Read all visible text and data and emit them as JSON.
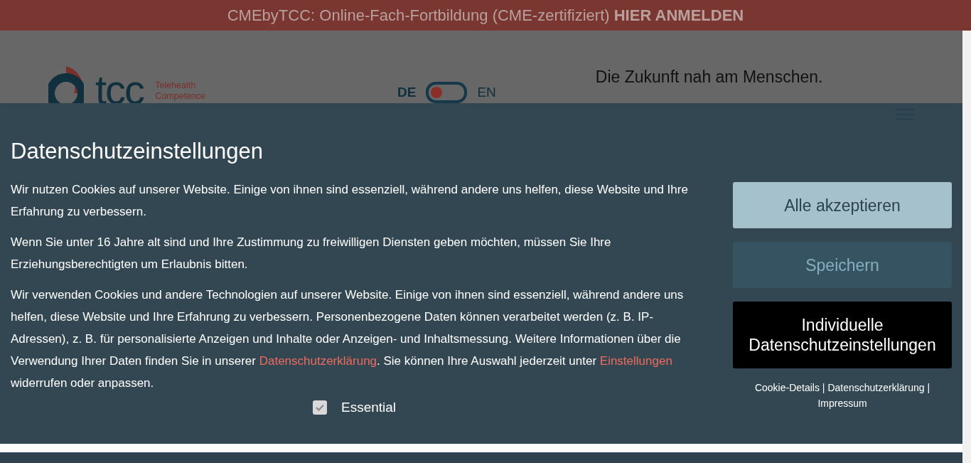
{
  "banner": {
    "text": "CMEbyTCC: Online-Fach-Fortbildung (CME-zertifiziert) **HIER ANMELDEN**"
  },
  "header": {
    "logo": {
      "wordmark": "tcc",
      "lines": [
        "Telehealth",
        "Competence"
      ]
    },
    "languages": [
      {
        "label": "DE",
        "selected": true
      },
      {
        "label": "EN",
        "selected": false
      }
    ],
    "tagline": "Die Zukunft nah am Menschen."
  },
  "cookie_panel": {
    "title": "Datenschutzeinstellungen",
    "paragraphs": [
      {
        "parts": [
          {
            "kind": "text",
            "text": "Wir nutzen Cookies auf unserer Website. Einige von ihnen sind essenziell, während andere uns helfen, diese Website und Ihre Erfahrung zu verbessern."
          }
        ]
      },
      {
        "parts": [
          {
            "kind": "text",
            "text": "Wenn Sie unter 16 Jahre alt sind und Ihre Zustimmung zu freiwilligen Diensten geben möchten, müssen Sie Ihre Erziehungsberechtigten um Erlaubnis bitten."
          }
        ]
      },
      {
        "parts": [
          {
            "kind": "text",
            "text": "Wir verwenden Cookies und andere Technologien auf unserer Website. Einige von ihnen sind essenziell, während andere uns helfen, diese Website und Ihre Erfahrung zu verbessern. Personenbezogene Daten können verarbeitet werden (z. B. IP-Adressen), z. B. für personalisierte Anzeigen und Inhalte oder Anzeigen- und Inhaltsmessung. Weitere Informationen über die Verwendung Ihrer Daten finden Sie in unserer "
          },
          {
            "kind": "link",
            "text": "Datenschutzerklärung"
          },
          {
            "kind": "text",
            "text": ". Sie können Ihre Auswahl jederzeit unter "
          },
          {
            "kind": "link",
            "text": "Einstellungen"
          },
          {
            "kind": "text",
            "text": " widerrufen oder anpassen."
          }
        ]
      }
    ],
    "checkboxes": [
      {
        "label": "Essential",
        "checked": true,
        "disabled": true
      }
    ],
    "buttons": [
      {
        "label": "Alle akzeptieren",
        "kind": "primary"
      },
      {
        "label": "Speichern",
        "kind": "secondary"
      },
      {
        "label": "Individuelle Datenschutzeinstellungen",
        "kind": "dark"
      }
    ],
    "footer_links": [
      "Cookie-Details",
      "Datenschutzerklärung",
      "Impressum"
    ],
    "footer_separator": "|"
  }
}
